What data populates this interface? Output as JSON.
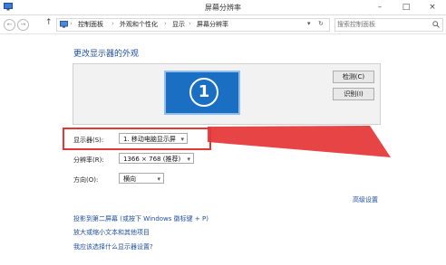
{
  "window": {
    "title": "屏幕分辨率",
    "minimize": "–",
    "maximize": "□",
    "close": "×"
  },
  "nav": {
    "back": "←",
    "forward": "→",
    "up": "↑",
    "crumbs": [
      "控制面板",
      "外观和个性化",
      "显示",
      "屏幕分辨率"
    ],
    "separator": "›",
    "dropdown": "▾",
    "refresh": "↻",
    "search_placeholder": "搜索控制面板"
  },
  "main": {
    "heading": "更改显示器的外观",
    "monitor_number": "1",
    "detect_button": "检测(C)",
    "identify_button": "识别(I)",
    "display_label": "显示器(S):",
    "display_value": "1. 移动电脑显示屏",
    "resolution_label": "分辨率(R):",
    "resolution_value": "1366 × 768 (推荐)",
    "orientation_label": "方向(O):",
    "orientation_value": "横向",
    "advanced_link": "高级设置",
    "project_link": "投影到第二屏幕 (或按下 Windows 徽标键 + P)",
    "text_size_link": "放大或缩小文本和其他项目",
    "which_settings_link": "我应该选择什么显示器设置?"
  },
  "colors": {
    "highlight": "#e53535",
    "link": "#1e4e9f",
    "monitor": "#1a6fc2"
  }
}
